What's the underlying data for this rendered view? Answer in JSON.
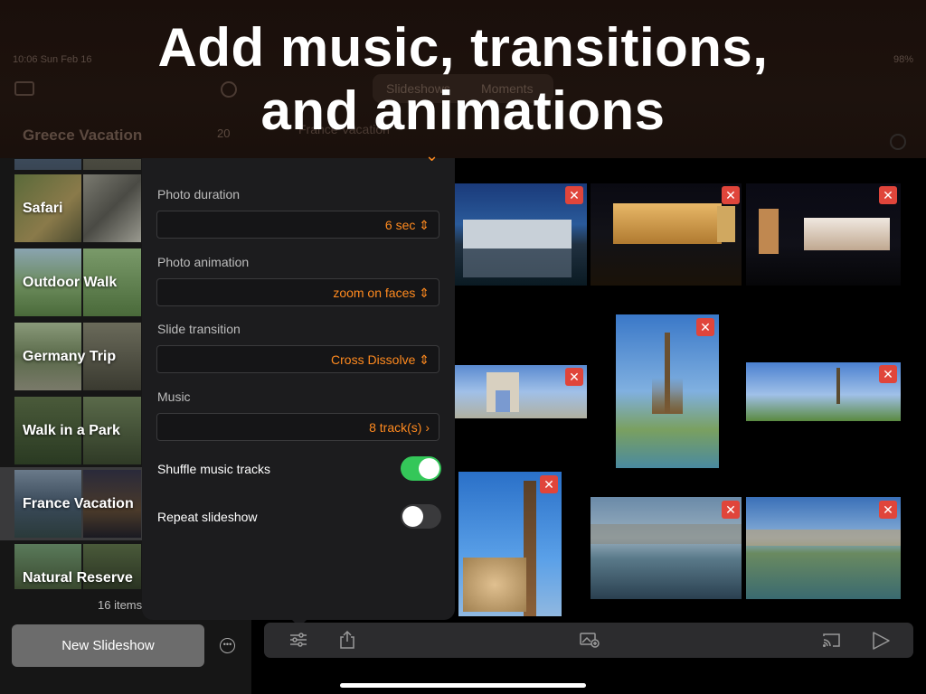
{
  "headline": {
    "line1": "Add music, transitions,",
    "line2": "and animations"
  },
  "status": {
    "time": "10:06  Sun Feb 16",
    "battery": "98%"
  },
  "top_tabs": [
    "Slideshows",
    "Moments"
  ],
  "sidebar": {
    "title": "Greece Vacation",
    "count_badge": "20",
    "albums": [
      {
        "label": "Safari"
      },
      {
        "label": "Outdoor Walk"
      },
      {
        "label": "Germany Trip"
      },
      {
        "label": "Walk in a Park"
      },
      {
        "label": "France Vacation",
        "selected": true
      },
      {
        "label": "Natural Reserve"
      }
    ],
    "items_count": "16 items",
    "new_button": "New Slideshow"
  },
  "main_header": "France Vacation",
  "popover": {
    "close_icon": "chevron-down-icon",
    "photo_duration": {
      "label": "Photo duration",
      "value": "6 sec"
    },
    "photo_animation": {
      "label": "Photo animation",
      "value": "zoom on faces"
    },
    "slide_transition": {
      "label": "Slide transition",
      "value": "Cross Dissolve"
    },
    "music": {
      "label": "Music",
      "value": "8 track(s)"
    },
    "shuffle": {
      "label": "Shuffle music tracks",
      "on": true
    },
    "repeat": {
      "label": "Repeat slideshow",
      "on": false
    }
  },
  "toolbar": {
    "icons": [
      "sliders-icon",
      "share-icon",
      "add-photo-icon",
      "airplay-icon",
      "play-icon"
    ]
  },
  "colors": {
    "accent": "#ff8a1f",
    "toggle_on": "#34c759",
    "delete_badge": "#e0453b"
  }
}
